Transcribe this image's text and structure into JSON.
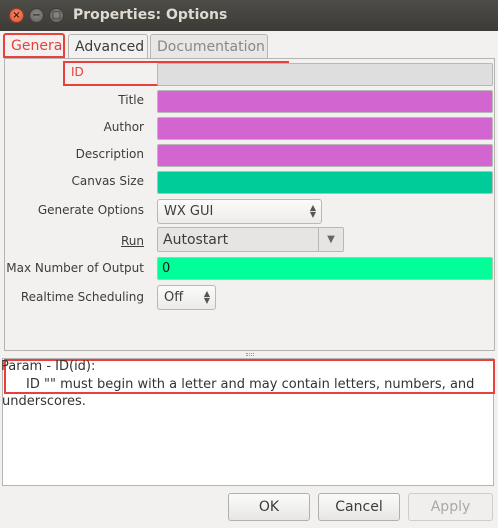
{
  "window": {
    "title": "Properties: Options",
    "close_glyph": "×",
    "minimize_glyph": "−",
    "maximize_glyph": "□"
  },
  "tabs": [
    {
      "label": "General",
      "active": true
    },
    {
      "label": "Advanced",
      "active": false
    },
    {
      "label": "Documentation",
      "active": false
    }
  ],
  "form": {
    "id": {
      "label": "ID",
      "value": "",
      "color": "#dedede"
    },
    "title": {
      "label": "Title",
      "value": "",
      "color": "#d265d0"
    },
    "author": {
      "label": "Author",
      "value": "",
      "color": "#d265d0"
    },
    "description": {
      "label": "Description",
      "value": "",
      "color": "#d265d0"
    },
    "canvas_size": {
      "label": "Canvas Size",
      "value": "",
      "color": "#00cc99"
    },
    "generate_options": {
      "label": "Generate Options",
      "value": "WX GUI"
    },
    "run": {
      "label": "Run",
      "value": "Autostart"
    },
    "max_outputs": {
      "label": "Max Number of Output",
      "value": "0",
      "color": "#00ff99"
    },
    "realtime": {
      "label": "Realtime Scheduling",
      "value": "Off"
    }
  },
  "help": {
    "heading": "Param - ID(id):",
    "text": "ID \"\" must begin with a letter and may contain letters, numbers, and underscores."
  },
  "buttons": {
    "ok": "OK",
    "cancel": "Cancel",
    "apply": "Apply"
  },
  "icons": {
    "spin": "spin-arrows-icon",
    "dropdown": "chevron-down-icon"
  },
  "colors": {
    "highlight": "#e8403c",
    "string_field": "#d265d0",
    "int_vector_field": "#00cc99",
    "int_field": "#00ff99"
  }
}
